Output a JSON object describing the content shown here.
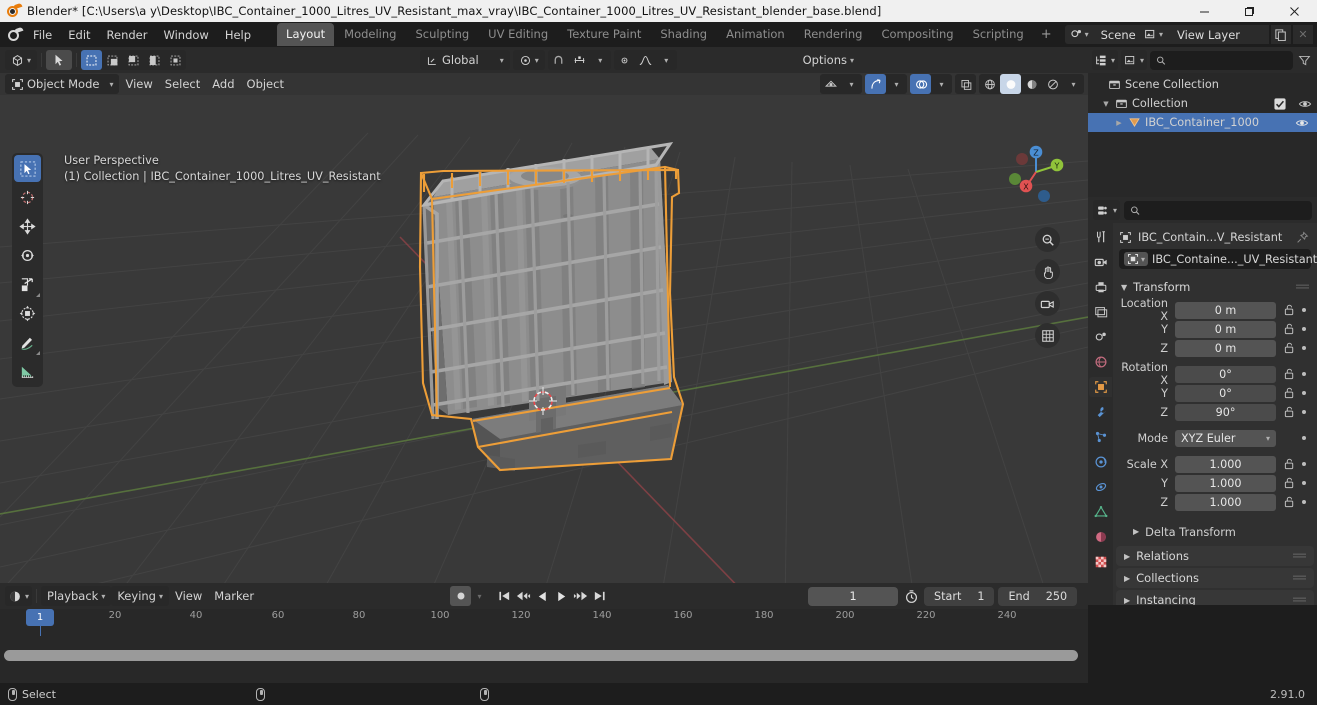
{
  "window": {
    "title": "Blender* [C:\\Users\\a y\\Desktop\\IBC_Container_1000_Litres_UV_Resistant_max_vray\\IBC_Container_1000_Litres_UV_Resistant_blender_base.blend]",
    "minimize": "–",
    "maximize": "❐",
    "close": "✕"
  },
  "topbar": {
    "menus": [
      "File",
      "Edit",
      "Render",
      "Window",
      "Help"
    ],
    "workspaces": [
      {
        "label": "Layout",
        "active": true
      },
      {
        "label": "Modeling",
        "active": false
      },
      {
        "label": "Sculpting",
        "active": false
      },
      {
        "label": "UV Editing",
        "active": false
      },
      {
        "label": "Texture Paint",
        "active": false
      },
      {
        "label": "Shading",
        "active": false
      },
      {
        "label": "Animation",
        "active": false
      },
      {
        "label": "Rendering",
        "active": false
      },
      {
        "label": "Compositing",
        "active": false
      },
      {
        "label": "Scripting",
        "active": false
      }
    ],
    "add_workspace": "+",
    "scene_name": "Scene",
    "view_layer_name": "View Layer"
  },
  "viewport": {
    "header": {
      "editor_type": "editor-type-3dview",
      "transform_orientation": "Global",
      "options": "Options"
    },
    "header2": {
      "mode": "Object Mode",
      "menus": [
        "View",
        "Select",
        "Add",
        "Object"
      ]
    },
    "overlay_text_line1": "User Perspective",
    "overlay_text_line2": "(1) Collection | IBC_Container_1000_Litres_UV_Resistant",
    "gizmo_axes": {
      "x": "X",
      "y": "Y",
      "z": "Z"
    },
    "gizmo_colors": {
      "x": "#e05252",
      "y": "#90c33a",
      "z": "#4a8ed4"
    },
    "tools": [
      {
        "name": "tweak-tool",
        "selected": true
      },
      {
        "name": "cursor-tool",
        "selected": false
      },
      {
        "name": "move-tool",
        "selected": false
      },
      {
        "name": "rotate-tool",
        "selected": false
      },
      {
        "name": "scale-tool",
        "selected": false
      },
      {
        "name": "transform-tool",
        "selected": false
      },
      {
        "name": "annotate-tool",
        "selected": false
      },
      {
        "name": "measure-tool",
        "selected": false
      }
    ],
    "object_outline_color": "#ed9e38",
    "model_color": "#8b8b8b",
    "background_color": "#393939"
  },
  "outliner": {
    "search_placeholder": "",
    "items": [
      {
        "label": "Scene Collection",
        "depth": 0,
        "icon": "collection-icon",
        "selected": false,
        "has_check": false,
        "has_eye": false,
        "expand": ""
      },
      {
        "label": "Collection",
        "depth": 1,
        "icon": "collection-icon",
        "selected": false,
        "has_check": true,
        "has_eye": true,
        "expand": "▼"
      },
      {
        "label": "IBC_Container_1000",
        "depth": 2,
        "icon": "mesh-object-icon",
        "selected": true,
        "has_check": false,
        "has_eye": true,
        "expand": "▶"
      }
    ]
  },
  "properties": {
    "search_placeholder": "",
    "breadcrumb_object": "IBC_Contain...V_Resistant",
    "object_id_field": "IBC_Containe..._UV_Resistant",
    "panels": {
      "transform": {
        "title": "Transform",
        "rows": [
          {
            "label": "Location X",
            "value": "0 m"
          },
          {
            "label": "Y",
            "value": "0 m"
          },
          {
            "label": "Z",
            "value": "0 m"
          }
        ],
        "rotation": [
          {
            "label": "Rotation X",
            "value": "0°"
          },
          {
            "label": "Y",
            "value": "0°"
          },
          {
            "label": "Z",
            "value": "90°"
          }
        ],
        "mode_label": "Mode",
        "mode_value": "XYZ Euler",
        "scale": [
          {
            "label": "Scale X",
            "value": "1.000"
          },
          {
            "label": "Y",
            "value": "1.000"
          },
          {
            "label": "Z",
            "value": "1.000"
          }
        ],
        "delta_transform": "Delta Transform"
      },
      "closed": [
        "Relations",
        "Collections",
        "Instancing"
      ]
    },
    "tabs": [
      {
        "name": "tool-tab",
        "active": false
      },
      {
        "name": "render-tab",
        "active": false
      },
      {
        "name": "output-tab",
        "active": false
      },
      {
        "name": "view-layer-tab",
        "active": false
      },
      {
        "name": "scene-tab",
        "active": false
      },
      {
        "name": "world-tab",
        "active": false
      },
      {
        "name": "object-tab",
        "active": true
      },
      {
        "name": "modifiers-tab",
        "active": false
      },
      {
        "name": "particles-tab",
        "active": false
      },
      {
        "name": "physics-tab",
        "active": false
      },
      {
        "name": "constraints-tab",
        "active": false
      },
      {
        "name": "object-data-tab",
        "active": false
      },
      {
        "name": "material-tab",
        "active": false
      },
      {
        "name": "texture-tab",
        "active": false
      }
    ]
  },
  "timeline": {
    "menus": [
      "Playback",
      "Keying",
      "View",
      "Marker"
    ],
    "current_frame": "1",
    "start_label": "Start",
    "start_value": "1",
    "end_label": "End",
    "end_value": "250",
    "ruler_ticks": [
      "20",
      "40",
      "60",
      "80",
      "100",
      "120",
      "140",
      "160",
      "180",
      "200",
      "220",
      "240"
    ],
    "playhead_frame": "1"
  },
  "statusbar": {
    "select_label": "Select",
    "version": "2.91.0"
  }
}
